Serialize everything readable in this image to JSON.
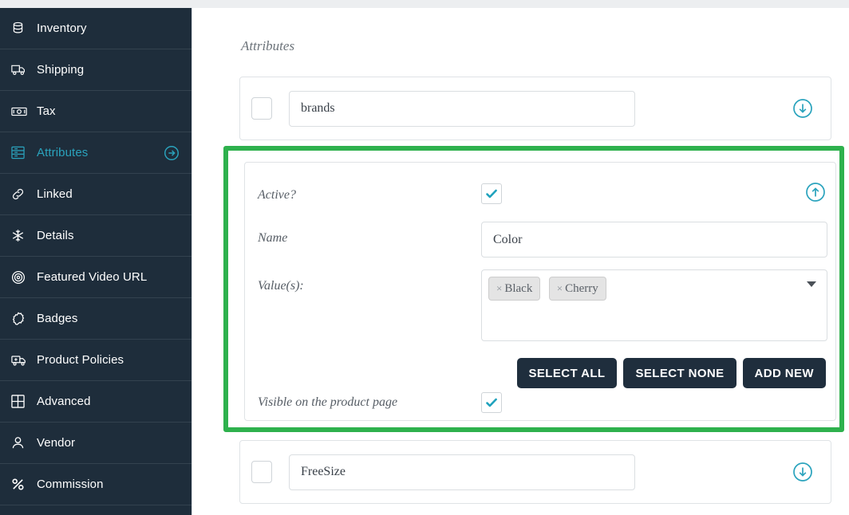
{
  "sidebar": {
    "items": [
      {
        "label": "Inventory",
        "icon": "database-icon",
        "active": false,
        "has_arrow": false
      },
      {
        "label": "Shipping",
        "icon": "truck-icon",
        "active": false,
        "has_arrow": false
      },
      {
        "label": "Tax",
        "icon": "money-icon",
        "active": false,
        "has_arrow": false
      },
      {
        "label": "Attributes",
        "icon": "list-panel-icon",
        "active": true,
        "has_arrow": true
      },
      {
        "label": "Linked",
        "icon": "link-icon",
        "active": false,
        "has_arrow": false
      },
      {
        "label": "Details",
        "icon": "snowflake-icon",
        "active": false,
        "has_arrow": false
      },
      {
        "label": "Featured Video URL",
        "icon": "target-icon",
        "active": false,
        "has_arrow": false
      },
      {
        "label": "Badges",
        "icon": "badge-icon",
        "active": false,
        "has_arrow": false
      },
      {
        "label": "Product Policies",
        "icon": "ambulance-icon",
        "active": false,
        "has_arrow": false
      },
      {
        "label": "Advanced",
        "icon": "grid-icon",
        "active": false,
        "has_arrow": false
      },
      {
        "label": "Vendor",
        "icon": "user-icon",
        "active": false,
        "has_arrow": false
      },
      {
        "label": "Commission",
        "icon": "percent-icon",
        "active": false,
        "has_arrow": false
      }
    ]
  },
  "main": {
    "section_title": "Attributes",
    "attribute_rows": [
      {
        "name_value": "brands",
        "checkbox_checked": false,
        "toggle_icon": "circle-arrow-down-icon"
      },
      {
        "name_value": "FreeSize",
        "checkbox_checked": false,
        "toggle_icon": "circle-arrow-down-icon"
      }
    ],
    "expanded_attribute": {
      "highlighted": true,
      "highlight_color": "#2eb14d",
      "toggle_icon": "circle-arrow-up-icon",
      "active_label": "Active?",
      "active_checked": true,
      "name_label": "Name",
      "name_value": "Color",
      "values_label": "Value(s):",
      "values_tags": [
        "Black",
        "Cherry"
      ],
      "tag_remove_glyph": "×",
      "buttons": [
        {
          "label": "SELECT ALL"
        },
        {
          "label": "SELECT NONE"
        },
        {
          "label": "ADD NEW"
        }
      ],
      "visible_label": "Visible on the product page",
      "visible_checked": true
    }
  },
  "colors": {
    "sidebar_bg": "#1e2d3b",
    "accent_teal": "#2aa3bd",
    "highlight_green": "#2eb14d",
    "button_dark": "#1f2e3d"
  }
}
